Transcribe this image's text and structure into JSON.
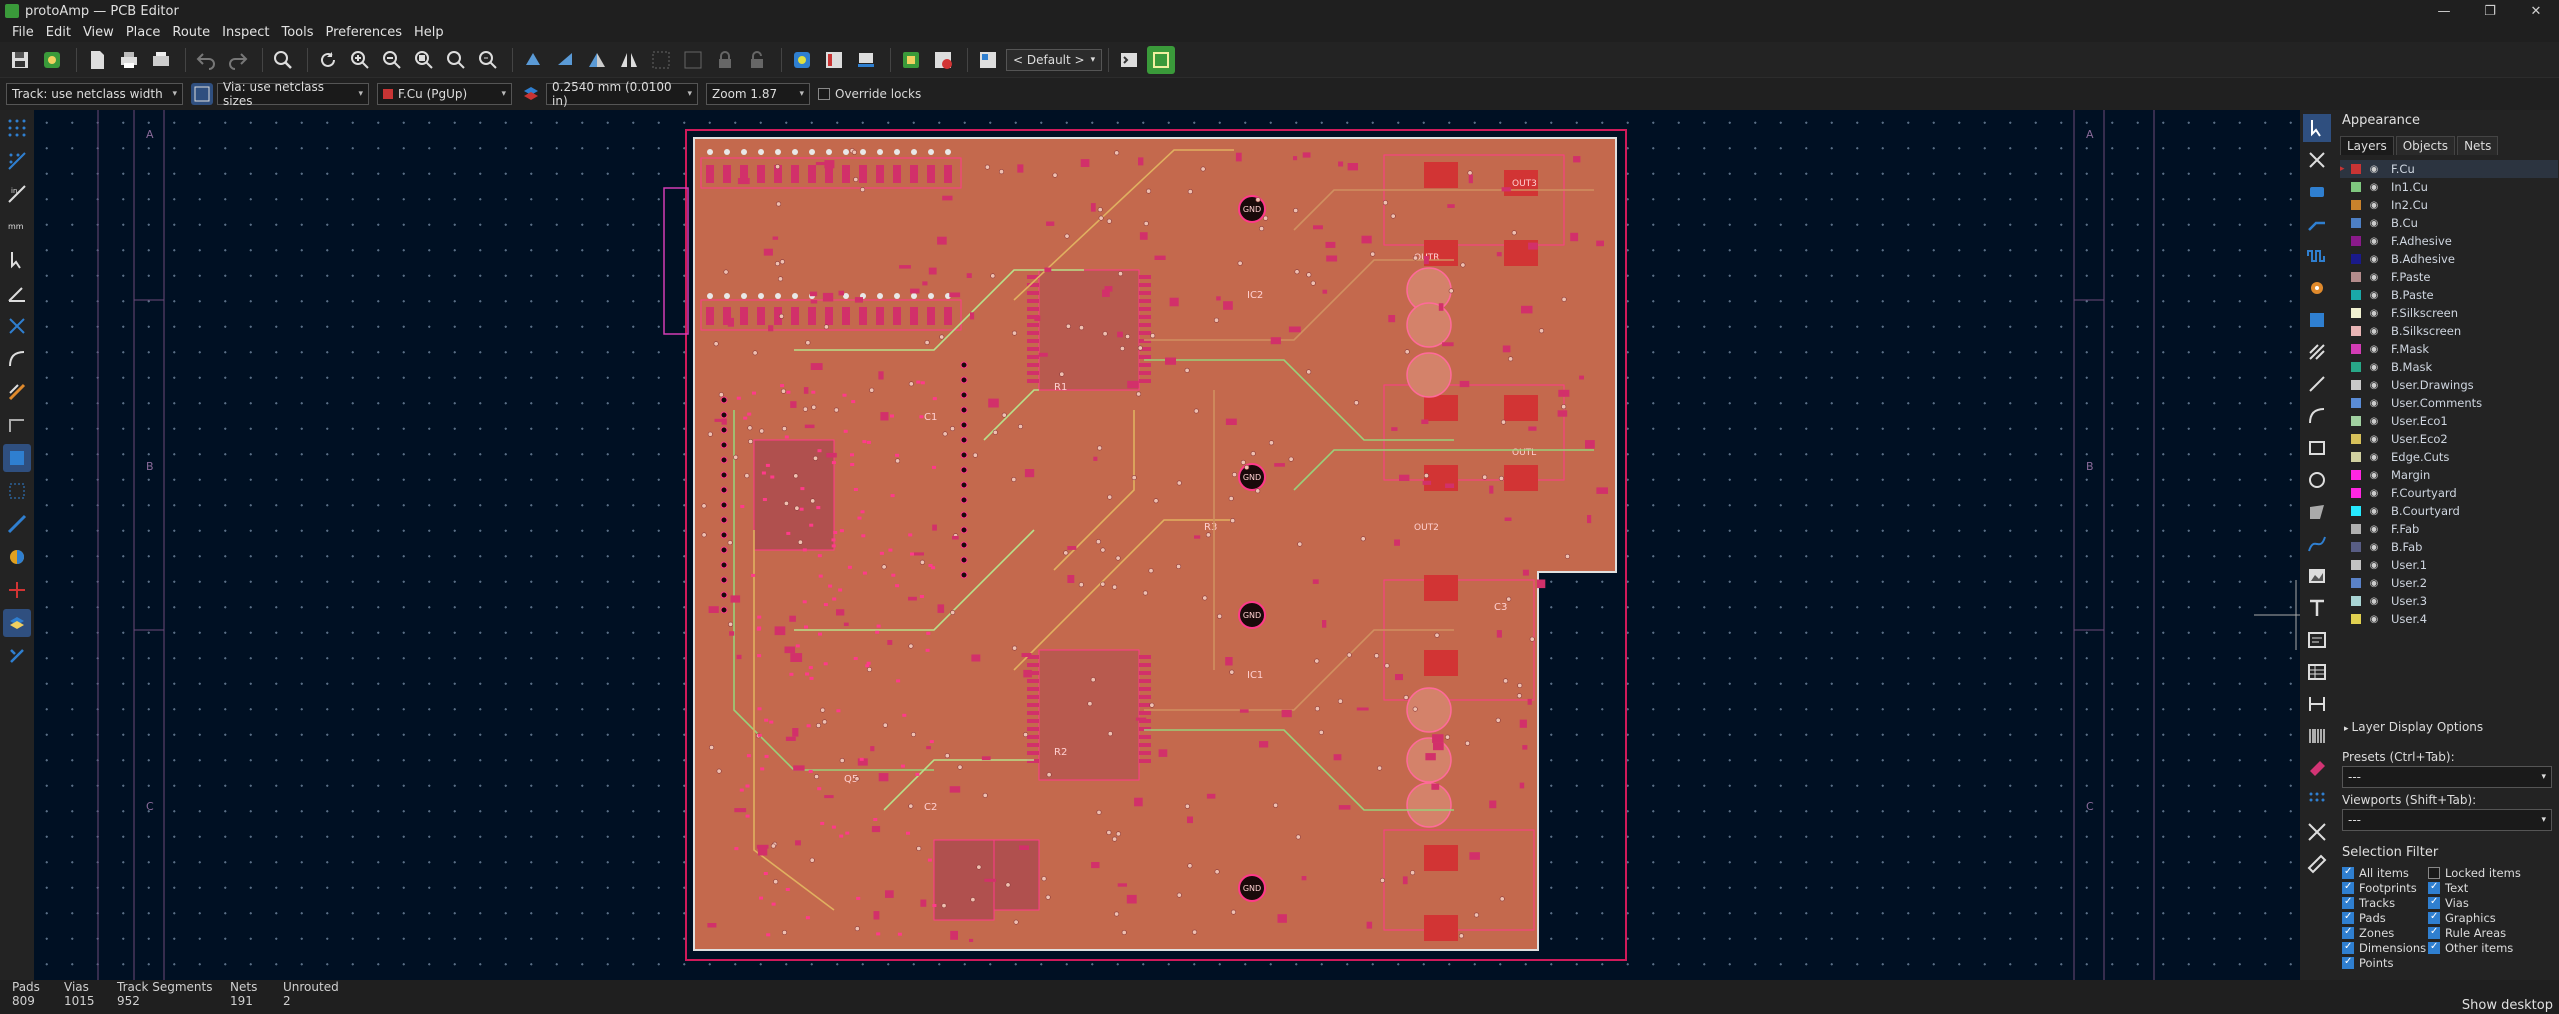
{
  "window": {
    "title": "protoAmp — PCB Editor",
    "minimize": "—",
    "restore": "❐",
    "close": "✕"
  },
  "menu": [
    "File",
    "Edit",
    "View",
    "Place",
    "Route",
    "Inspect",
    "Tools",
    "Preferences",
    "Help"
  ],
  "toolbar": {
    "preset_select": "< Default >"
  },
  "auxbar": {
    "track": "Track: use netclass width",
    "via": "Via: use netclass sizes",
    "layer": "F.Cu (PgUp)",
    "grid": "0.2540 mm (0.0100 in)",
    "zoom": "Zoom 1.87",
    "override_locks": "Override locks"
  },
  "colors": {
    "copper": "#c4694d",
    "canvas": "#001023",
    "board_edge": "#e0e0e0",
    "accent": "#2f7fd0"
  },
  "board": {
    "border_rows": [
      "A",
      "B",
      "C"
    ],
    "gnd_label": "GND",
    "out_labels": [
      "OUT3",
      "OUTR",
      "OUTL",
      "OUT2"
    ],
    "refs": [
      "IC2",
      "IC1",
      "R1",
      "R2",
      "R3",
      "C1",
      "C2",
      "C3",
      "Q5"
    ]
  },
  "panel": {
    "title": "Appearance",
    "tabs": [
      "Layers",
      "Objects",
      "Nets"
    ],
    "layers": [
      {
        "name": "F.Cu",
        "color": "#c83434"
      },
      {
        "name": "In1.Cu",
        "color": "#7fc87f"
      },
      {
        "name": "In2.Cu",
        "color": "#c8822c"
      },
      {
        "name": "B.Cu",
        "color": "#4d7fc4"
      },
      {
        "name": "F.Adhesive",
        "color": "#8a1a8a"
      },
      {
        "name": "B.Adhesive",
        "color": "#1a1a8a"
      },
      {
        "name": "F.Paste",
        "color": "#b48c8c"
      },
      {
        "name": "B.Paste",
        "color": "#1aa8a8"
      },
      {
        "name": "F.Silkscreen",
        "color": "#f0f0d0"
      },
      {
        "name": "B.Silkscreen",
        "color": "#e8b4b4"
      },
      {
        "name": "F.Mask",
        "color": "#d23cb4"
      },
      {
        "name": "B.Mask",
        "color": "#28a888"
      },
      {
        "name": "User.Drawings",
        "color": "#c8c8c8"
      },
      {
        "name": "User.Comments",
        "color": "#5a8cd6"
      },
      {
        "name": "User.Eco1",
        "color": "#a0d0a0"
      },
      {
        "name": "User.Eco2",
        "color": "#d6c05a"
      },
      {
        "name": "Edge.Cuts",
        "color": "#d0d0a0"
      },
      {
        "name": "Margin",
        "color": "#ff26e2"
      },
      {
        "name": "F.Courtyard",
        "color": "#ff26e2"
      },
      {
        "name": "B.Courtyard",
        "color": "#26e9ff"
      },
      {
        "name": "F.Fab",
        "color": "#afafaf"
      },
      {
        "name": "B.Fab",
        "color": "#585d84"
      },
      {
        "name": "User.1",
        "color": "#c2c2c2"
      },
      {
        "name": "User.2",
        "color": "#5a82c8"
      },
      {
        "name": "User.3",
        "color": "#a8d4d4"
      },
      {
        "name": "User.4",
        "color": "#e0d050"
      }
    ],
    "layer_display_options": "Layer Display Options",
    "presets_label": "Presets (Ctrl+Tab):",
    "presets_value": "---",
    "viewports_label": "Viewports (Shift+Tab):",
    "viewports_value": "---",
    "selection_filter": "Selection Filter",
    "filters": [
      "All items",
      "Locked items",
      "Footprints",
      "Text",
      "Tracks",
      "Vias",
      "Pads",
      "Graphics",
      "Zones",
      "Rule Areas",
      "Dimensions",
      "Other items",
      "Points"
    ]
  },
  "status": {
    "pads_label": "Pads",
    "pads": "809",
    "vias_label": "Vias",
    "vias": "1015",
    "segments_label": "Track Segments",
    "segments": "952",
    "nets_label": "Nets",
    "nets": "191",
    "unrouted_label": "Unrouted",
    "unrouted": "2",
    "show_desktop": "Show desktop"
  }
}
